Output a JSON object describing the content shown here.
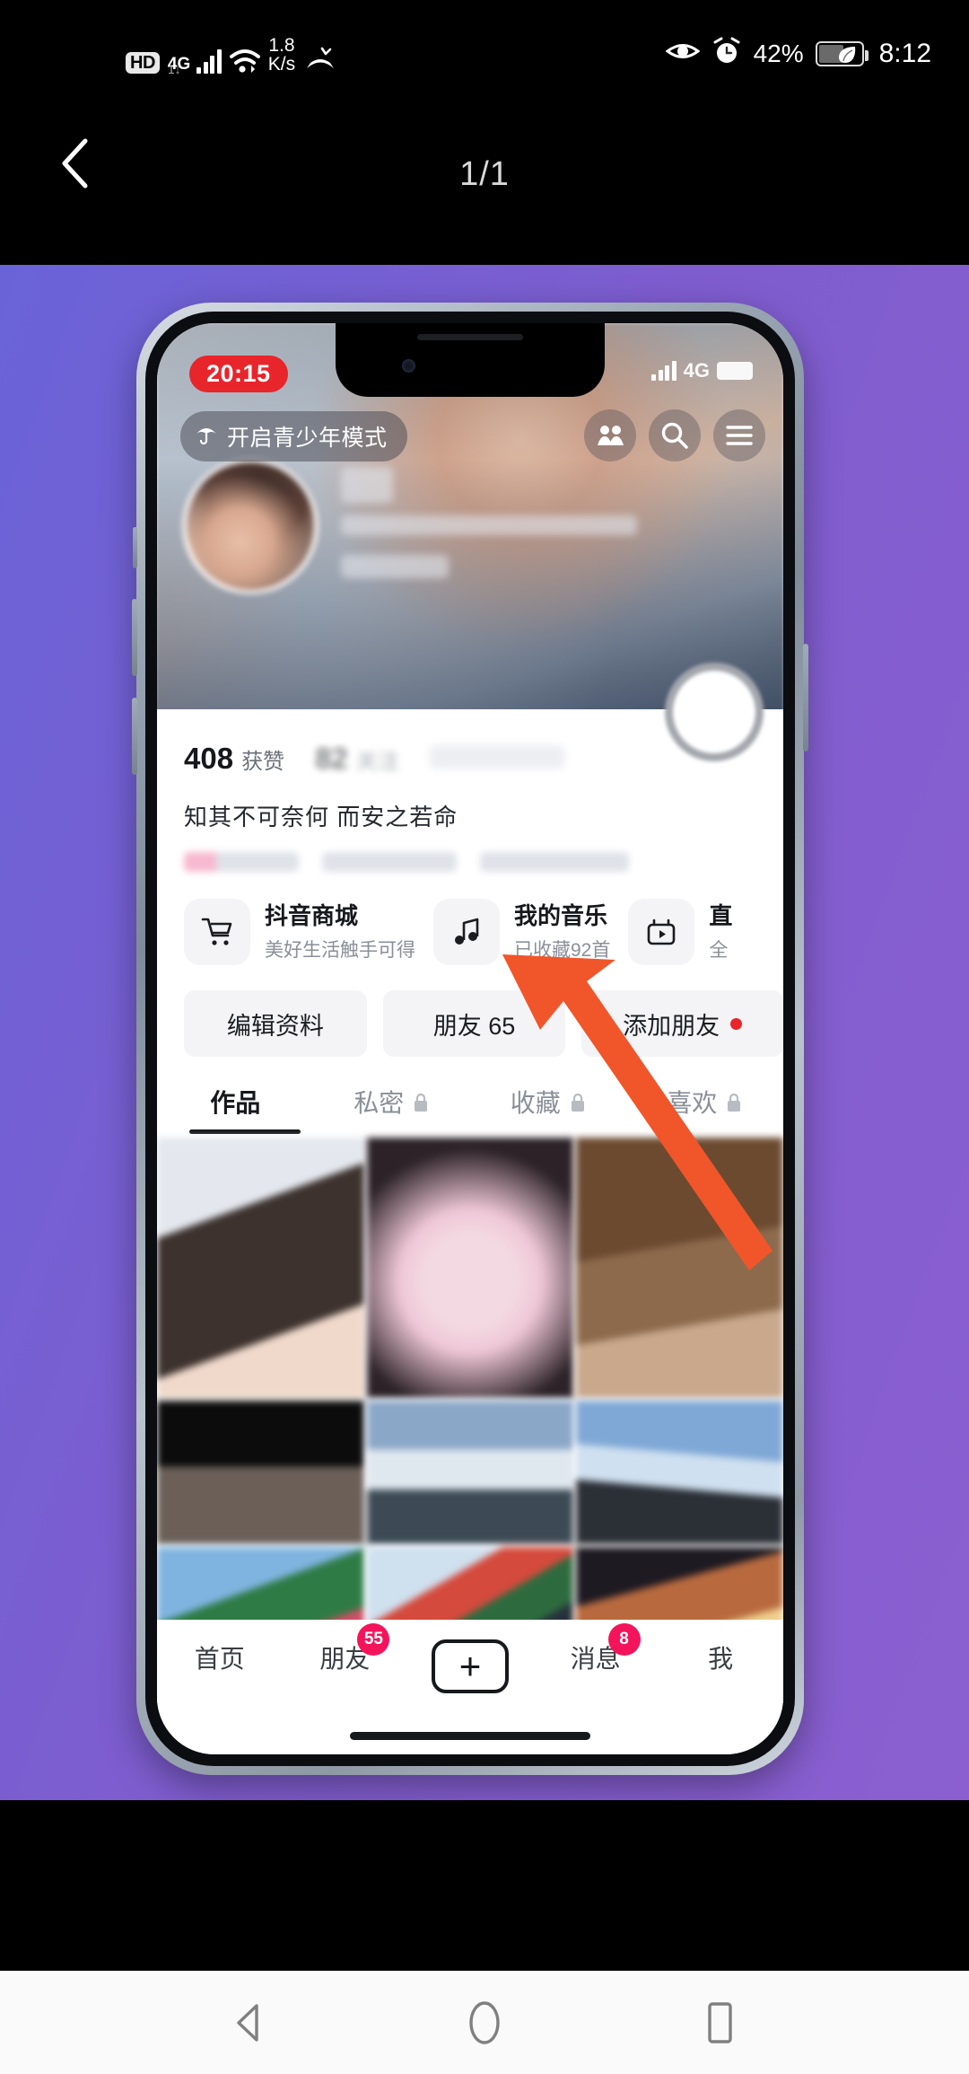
{
  "system_status_bar": {
    "hd_label": "HD",
    "network_label": "4G",
    "network_sub": "1↓",
    "data_speed": "1.8",
    "data_speed_unit": "K/s",
    "icons": [
      "hd-icon",
      "signal-bars-icon",
      "wifi-icon",
      "missed-call-icon",
      "eye-comfort-icon",
      "alarm-icon",
      "battery-saver-icon"
    ],
    "battery_percent": "42%",
    "clock": "8:12"
  },
  "app_header": {
    "back_icon": "back-chevron-icon",
    "page_indicator": "1/1"
  },
  "canvas": {
    "background_color": "#7e5dcf"
  },
  "phone_mockup": {
    "status": {
      "time_badge": "20:15",
      "network": "4G"
    },
    "teen_mode": {
      "icon": "umbrella-icon",
      "label": "开启青少年模式"
    },
    "header_icons": [
      {
        "name": "friends-icon",
        "glyph": "friends"
      },
      {
        "name": "search-icon",
        "glyph": "search"
      },
      {
        "name": "menu-icon",
        "glyph": "menu"
      }
    ],
    "profile": {
      "stats": [
        {
          "number": "408",
          "label": "获赞",
          "blurred": false
        },
        {
          "number": "82",
          "label": "关注",
          "blurred": true
        },
        {
          "number": "",
          "label": "",
          "blurred": true
        }
      ],
      "bio": "知其不可奈何 而安之若命"
    },
    "cards": [
      {
        "icon": "shopping-cart-icon",
        "title": "抖音商城",
        "subtitle": "美好生活触手可得"
      },
      {
        "icon": "music-note-icon",
        "title": "我的音乐",
        "subtitle": "已收藏92首"
      },
      {
        "icon": "video-album-icon",
        "title": "直",
        "subtitle": "全"
      }
    ],
    "actions": [
      {
        "label": "编辑资料",
        "dot": false
      },
      {
        "label": "朋友 65",
        "dot": false
      },
      {
        "label": "添加朋友",
        "dot": true
      }
    ],
    "tabs": [
      {
        "label": "作品",
        "locked": false,
        "active": true
      },
      {
        "label": "私密",
        "locked": true,
        "active": false
      },
      {
        "label": "收藏",
        "locked": true,
        "active": false
      },
      {
        "label": "喜欢",
        "locked": true,
        "active": false
      }
    ],
    "bottom_nav": [
      {
        "label": "首页",
        "badge": "",
        "type": "text"
      },
      {
        "label": "朋友",
        "badge": "55",
        "type": "text"
      },
      {
        "label": "",
        "badge": "",
        "type": "plus"
      },
      {
        "label": "消息",
        "badge": "8",
        "type": "text"
      },
      {
        "label": "我",
        "badge": "",
        "type": "text"
      }
    ]
  },
  "annotation": {
    "arrow_color": "#F0562A",
    "arrow_name": "pointer-arrow"
  },
  "android_nav": {
    "back": "back-triangle-icon",
    "home": "home-circle-icon",
    "recents": "recents-square-icon"
  }
}
